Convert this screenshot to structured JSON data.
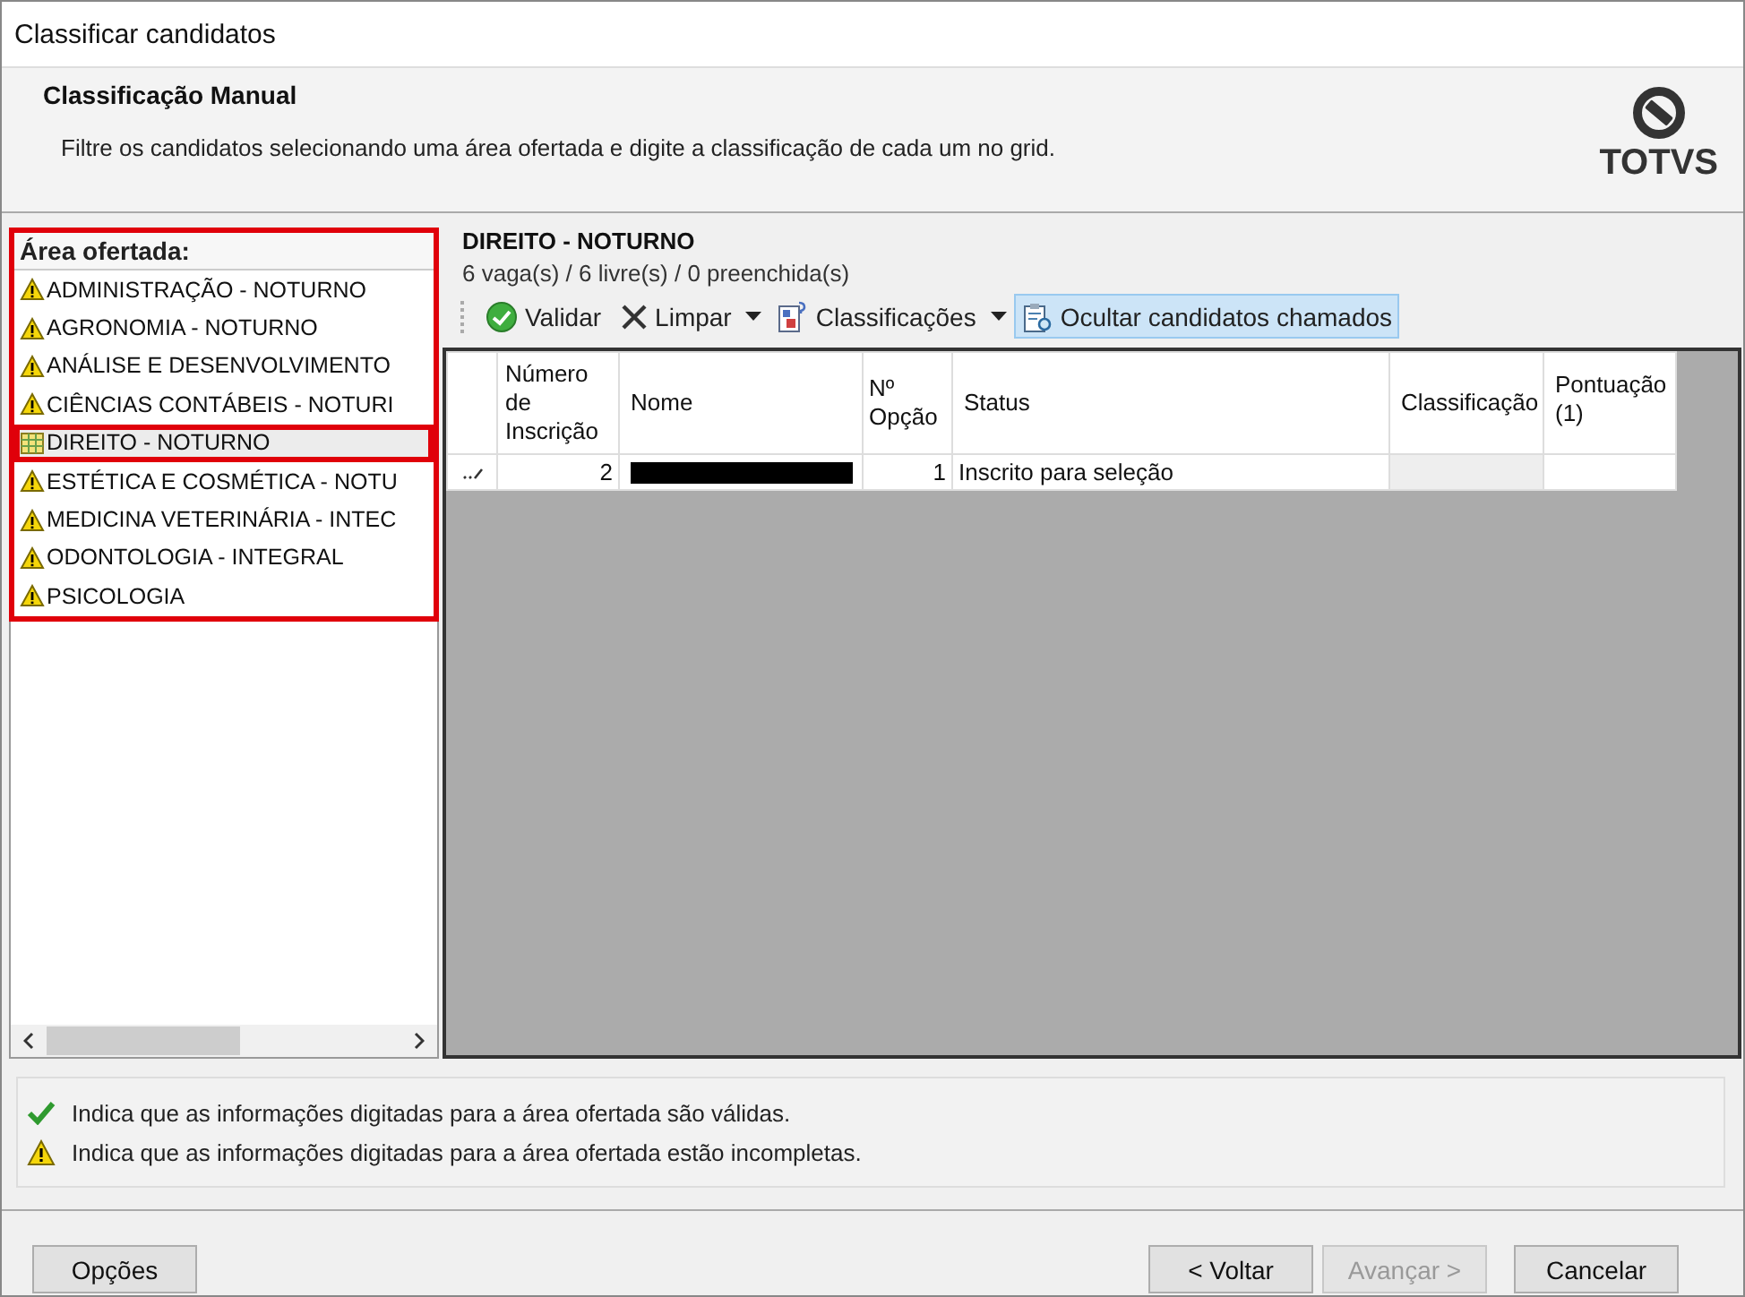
{
  "window": {
    "title": "Classificar candidatos"
  },
  "header": {
    "title": "Classificação Manual",
    "description": "Filtre os candidatos selecionando uma área ofertada e digite a classificação de cada um no grid.",
    "logo_text": "TOTVS"
  },
  "areas": {
    "title": "Área ofertada:",
    "items": [
      {
        "label": "ADMINISTRAÇÃO - NOTURNO",
        "kind": "warning",
        "selected": false
      },
      {
        "label": "AGRONOMIA - NOTURNO",
        "kind": "warning",
        "selected": false
      },
      {
        "label": "ANÁLISE E DESENVOLVIMENTO",
        "kind": "warning",
        "selected": false
      },
      {
        "label": "CIÊNCIAS CONTÁBEIS - NOTURI",
        "kind": "warning",
        "selected": false
      },
      {
        "label": "DIREITO - NOTURNO",
        "kind": "grid",
        "selected": true
      },
      {
        "label": "ESTÉTICA E COSMÉTICA - NOTU",
        "kind": "warning",
        "selected": false
      },
      {
        "label": "MEDICINA VETERINÁRIA - INTEC",
        "kind": "warning",
        "selected": false
      },
      {
        "label": "ODONTOLOGIA - INTEGRAL",
        "kind": "warning",
        "selected": false
      },
      {
        "label": "PSICOLOGIA",
        "kind": "warning",
        "selected": false
      }
    ]
  },
  "detail": {
    "title": "DIREITO - NOTURNO",
    "summary": "6 vaga(s) / 6 livre(s) / 0 preenchida(s)"
  },
  "toolbar": [
    {
      "label": "Validar",
      "kind": "check",
      "dropdown": false,
      "selected": false
    },
    {
      "label": "Limpar",
      "kind": "clear",
      "dropdown": true,
      "selected": false
    },
    {
      "label": "Classificações",
      "kind": "numbers",
      "dropdown": true,
      "selected": false
    },
    {
      "label": "Ocultar candidatos chamados",
      "kind": "hide",
      "dropdown": false,
      "selected": true
    }
  ],
  "table": {
    "columns": [
      "Número de Inscrição",
      "Nome",
      "Nº Opção",
      "Status",
      "Classificação",
      "Pontuação (1)"
    ],
    "rows": [
      {
        "inscricao": "2",
        "nome_redacted": true,
        "opcao": "1",
        "status": "Inscrito para seleção",
        "classificacao": "",
        "pontuacao": ""
      }
    ]
  },
  "legend": [
    {
      "kind": "valid",
      "text": "Indica que as informações digitadas para a área ofertada são válidas."
    },
    {
      "kind": "warning",
      "text": "Indica que as informações digitadas para a área ofertada estão incompletas."
    }
  ],
  "buttons": [
    {
      "label": "Opções",
      "disabled": false
    },
    {
      "label": "< Voltar",
      "disabled": false
    },
    {
      "label": "Avançar >",
      "disabled": true
    },
    {
      "label": "Cancelar",
      "disabled": false
    }
  ]
}
